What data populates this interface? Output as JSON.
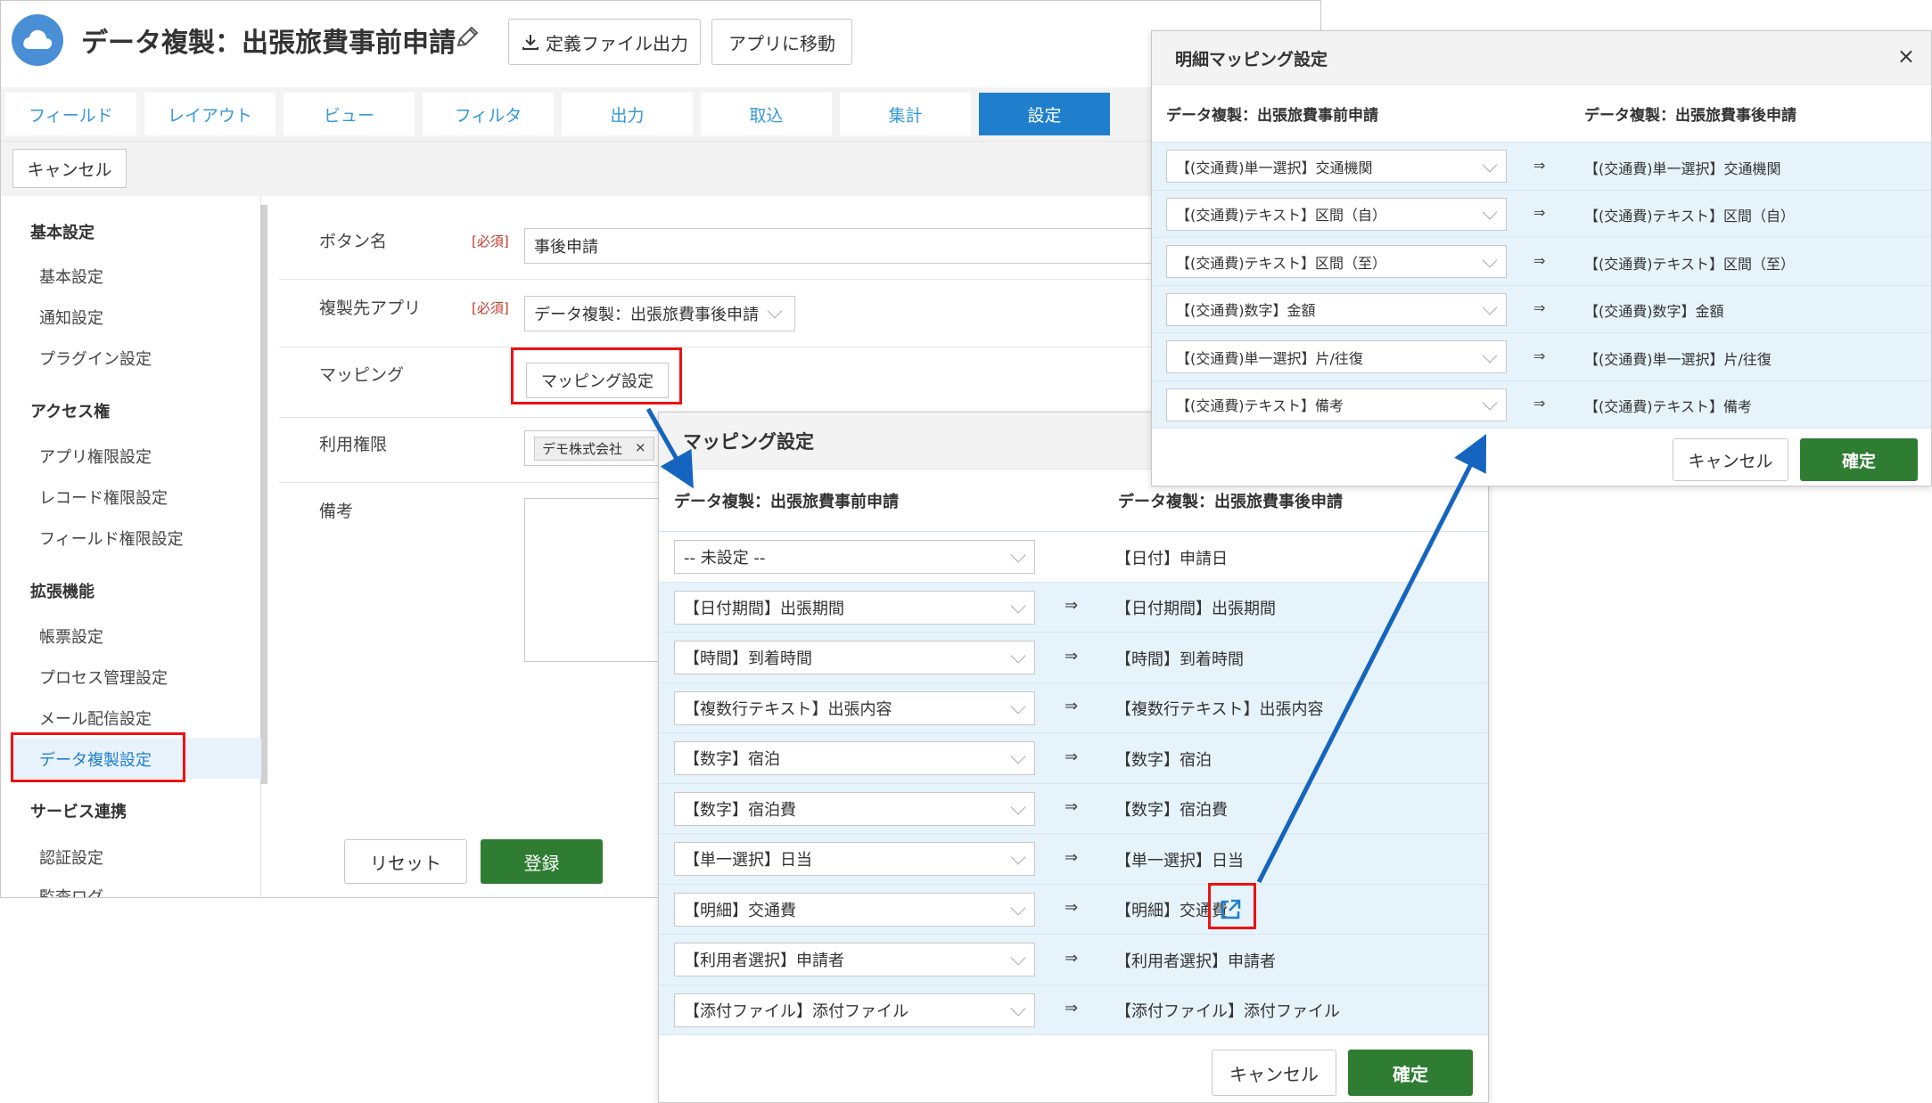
{
  "app": {
    "title": "データ複製：出張旅費事前申請",
    "export_button": "定義ファイル出力",
    "goto_app_button": "アプリに移動"
  },
  "tabs": [
    {
      "label": "フィールド"
    },
    {
      "label": "レイアウト"
    },
    {
      "label": "ビュー"
    },
    {
      "label": "フィルタ"
    },
    {
      "label": "出力"
    },
    {
      "label": "取込"
    },
    {
      "label": "集計"
    },
    {
      "label": "設定"
    }
  ],
  "toolbar": {
    "cancel_label": "キャンセル"
  },
  "sidebar": {
    "sections": [
      {
        "heading": "基本設定",
        "items": [
          "基本設定",
          "通知設定",
          "プラグイン設定"
        ]
      },
      {
        "heading": "アクセス権",
        "items": [
          "アプリ権限設定",
          "レコード権限設定",
          "フィールド権限設定"
        ]
      },
      {
        "heading": "拡張機能",
        "items": [
          "帳票設定",
          "プロセス管理設定",
          "メール配信設定",
          "データ複製設定"
        ]
      },
      {
        "heading": "サービス連携",
        "items": [
          "認証設定",
          "監査ログ"
        ]
      }
    ]
  },
  "form": {
    "button_name_label": "ボタン名",
    "required": "[必須]",
    "button_name_value": "事後申請",
    "dest_app_label": "複製先アプリ",
    "dest_app_value": "データ複製：出張旅費事後申請",
    "mapping_label": "マッピング",
    "mapping_button": "マッピング設定",
    "permission_label": "利用権限",
    "permission_tag": "デモ株式会社",
    "permission_tag_remove": "×",
    "notes_label": "備考",
    "reset_button": "リセット",
    "register_button": "登録"
  },
  "mapping_dialog": {
    "title": "マッピング設定",
    "source_header": "データ複製：出張旅費事前申請",
    "dest_header": "データ複製：出張旅費事後申請",
    "arrow": "⇒",
    "rows": [
      {
        "source": "-- 未設定 --",
        "dest": "【日付】申請日",
        "arrow": ""
      },
      {
        "source": "【日付期間】出張期間",
        "dest": "【日付期間】出張期間",
        "arrow": "⇒"
      },
      {
        "source": "【時間】到着時間",
        "dest": "【時間】到着時間",
        "arrow": "⇒"
      },
      {
        "source": "【複数行テキスト】出張内容",
        "dest": "【複数行テキスト】出張内容",
        "arrow": "⇒"
      },
      {
        "source": "【数字】宿泊",
        "dest": "【数字】宿泊",
        "arrow": "⇒"
      },
      {
        "source": "【数字】宿泊費",
        "dest": "【数字】宿泊費",
        "arrow": "⇒"
      },
      {
        "source": "【単一選択】日当",
        "dest": "【単一選択】日当",
        "arrow": "⇒"
      },
      {
        "source": "【明細】交通費",
        "dest": "【明細】交通費",
        "arrow": "⇒"
      },
      {
        "source": "【利用者選択】申請者",
        "dest": "【利用者選択】申請者",
        "arrow": "⇒"
      },
      {
        "source": "【添付ファイル】添付ファイル",
        "dest": "【添付ファイル】添付ファイル",
        "arrow": "⇒"
      }
    ],
    "cancel_button": "キャンセル",
    "ok_button": "確定"
  },
  "detail_dialog": {
    "title": "明細マッピング設定",
    "close": "×",
    "source_header": "データ複製：出張旅費事前申請",
    "dest_header": "データ複製：出張旅費事後申請",
    "rows": [
      {
        "source": "【(交通費)単一選択】交通機関",
        "dest": "【(交通費)単一選択】交通機関",
        "arrow": "⇒"
      },
      {
        "source": "【(交通費)テキスト】区間（自）",
        "dest": "【(交通費)テキスト】区間（自）",
        "arrow": "⇒"
      },
      {
        "source": "【(交通費)テキスト】区間（至）",
        "dest": "【(交通費)テキスト】区間（至）",
        "arrow": "⇒"
      },
      {
        "source": "【(交通費)数字】金額",
        "dest": "【(交通費)数字】金額",
        "arrow": "⇒"
      },
      {
        "source": "【(交通費)単一選択】片/往復",
        "dest": "【(交通費)単一選択】片/往復",
        "arrow": "⇒"
      },
      {
        "source": "【(交通費)テキスト】備考",
        "dest": "【(交通費)テキスト】備考",
        "arrow": "⇒"
      }
    ],
    "cancel_button": "キャンセル",
    "ok_button": "確定"
  },
  "colors": {
    "accent_blue": "#1f7fcd",
    "ok_green": "#2e7d32",
    "highlight_red": "#e11111",
    "row_blue": "#e6f3fb",
    "annotation_arrow": "#1565c0"
  },
  "icons": {
    "logo": "cloud-icon",
    "edit": "pencil-icon",
    "download": "download-icon",
    "open_detail": "external-link-icon"
  }
}
